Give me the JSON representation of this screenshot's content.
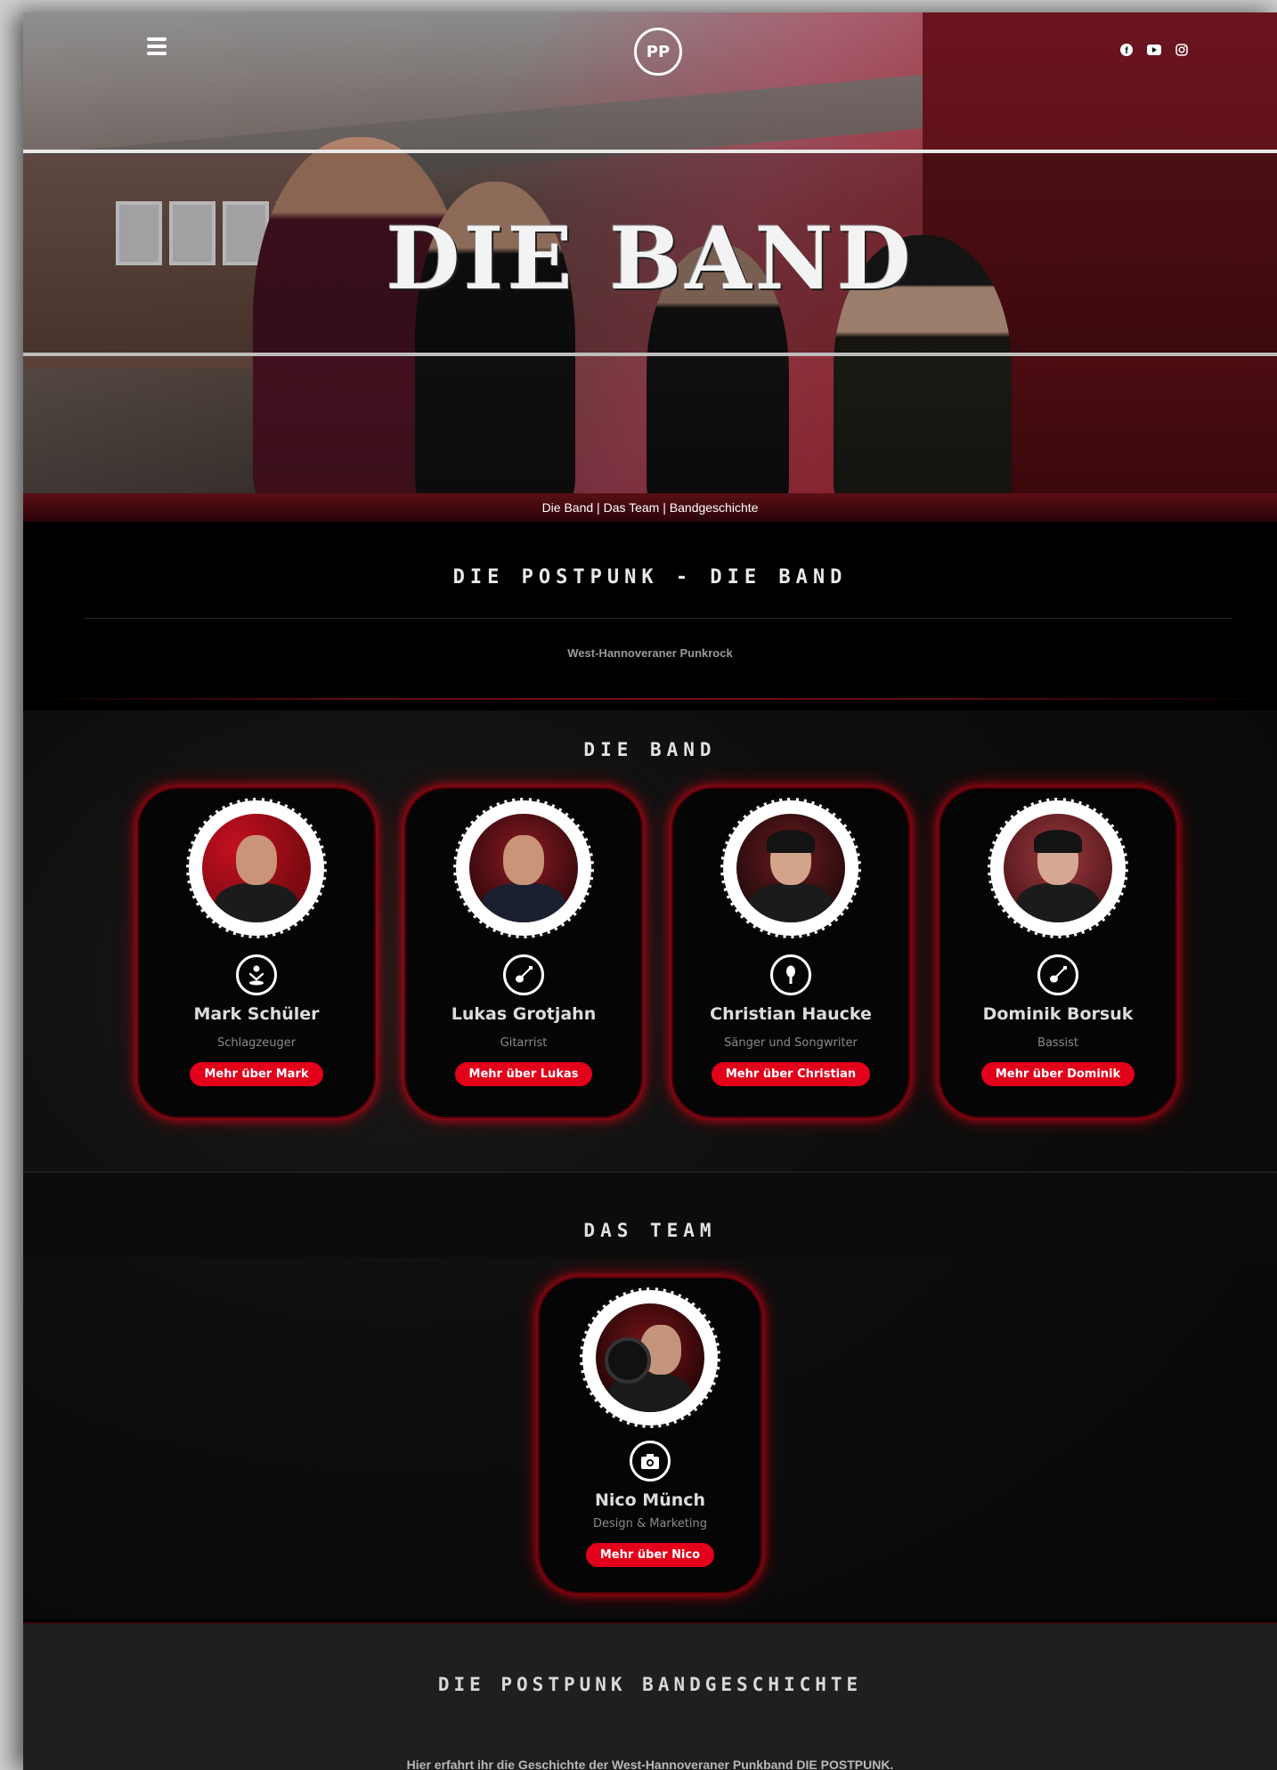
{
  "hero": {
    "title": "DIE BAND",
    "logo_text": "PP",
    "menu_icon": "hamburger-icon",
    "social": [
      {
        "name": "facebook-icon"
      },
      {
        "name": "youtube-icon"
      },
      {
        "name": "instagram-icon"
      }
    ]
  },
  "breadcrumb": {
    "items": [
      "Die Band",
      "Das Team",
      "Bandgeschichte"
    ],
    "separator": "|"
  },
  "intro": {
    "title": "DIE POSTPUNK - DIE BAND",
    "subtitle": "West-Hannoveraner Punkrock"
  },
  "band": {
    "title": "DIE BAND",
    "members": [
      {
        "name": "Mark Schüler",
        "role": "Schlagzeuger",
        "button": "Mehr über Mark",
        "icon": "drummer-icon"
      },
      {
        "name": "Lukas Grotjahn",
        "role": "Gitarrist",
        "button": "Mehr über Lukas",
        "icon": "guitar-icon"
      },
      {
        "name": "Christian Haucke",
        "role": "Sänger und Songwriter",
        "button": "Mehr über Christian",
        "icon": "microphone-icon"
      },
      {
        "name": "Dominik Borsuk",
        "role": "Bassist",
        "button": "Mehr über Dominik",
        "icon": "bass-guitar-icon"
      }
    ]
  },
  "team": {
    "title": "DAS TEAM",
    "members": [
      {
        "name": "Nico Münch",
        "role": "Design & Marketing",
        "button": "Mehr über Nico",
        "icon": "camera-icon"
      }
    ]
  },
  "history": {
    "title": "DIE POSTPUNK BANDGESCHICHTE",
    "text": "Hier erfahrt ihr die Geschichte der West-Hannoveraner Punkband DIE POSTPUNK."
  },
  "colors": {
    "accent": "#e2001a",
    "glow": "#e60014",
    "background": "#000000"
  }
}
